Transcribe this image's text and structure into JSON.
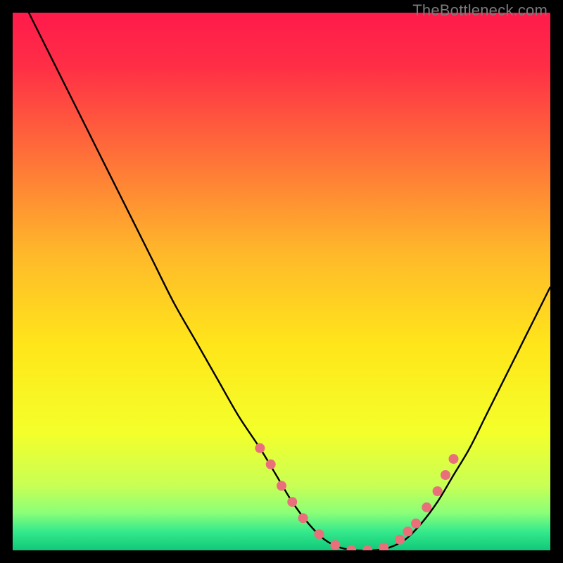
{
  "watermark": "TheBottleneck.com",
  "chart_data": {
    "type": "line",
    "title": "",
    "xlabel": "",
    "ylabel": "",
    "xlim": [
      0,
      100
    ],
    "ylim": [
      0,
      100
    ],
    "grid": false,
    "legend": false,
    "gradient_stops": [
      {
        "offset": 0.0,
        "color": "#ff1a4b"
      },
      {
        "offset": 0.1,
        "color": "#ff2e46"
      },
      {
        "offset": 0.25,
        "color": "#ff6a3a"
      },
      {
        "offset": 0.45,
        "color": "#ffb92a"
      },
      {
        "offset": 0.62,
        "color": "#ffe61a"
      },
      {
        "offset": 0.78,
        "color": "#f4ff2a"
      },
      {
        "offset": 0.88,
        "color": "#c8ff55"
      },
      {
        "offset": 0.93,
        "color": "#8bff78"
      },
      {
        "offset": 0.965,
        "color": "#35e98c"
      },
      {
        "offset": 1.0,
        "color": "#10c879"
      }
    ],
    "series": [
      {
        "name": "curve",
        "x": [
          3,
          6,
          10,
          14,
          18,
          22,
          26,
          30,
          34,
          38,
          42,
          46,
          49,
          52,
          55,
          58,
          61,
          64,
          67,
          70,
          73,
          76,
          79,
          82,
          85,
          88,
          91,
          94,
          97,
          100
        ],
        "y": [
          100,
          94,
          86,
          78,
          70,
          62,
          54,
          46,
          39,
          32,
          25,
          19,
          14,
          9,
          5,
          2,
          0.5,
          0,
          0,
          0.5,
          2,
          5,
          9,
          14,
          19,
          25,
          31,
          37,
          43,
          49
        ]
      },
      {
        "name": "markers",
        "x": [
          46,
          48,
          50,
          52,
          54,
          57,
          60,
          63,
          66,
          69,
          72,
          73.5,
          75,
          77,
          79,
          80.5,
          82
        ],
        "y": [
          19,
          16,
          12,
          9,
          6,
          3,
          1,
          0,
          0,
          0.5,
          2,
          3.5,
          5,
          8,
          11,
          14,
          17
        ]
      }
    ]
  }
}
